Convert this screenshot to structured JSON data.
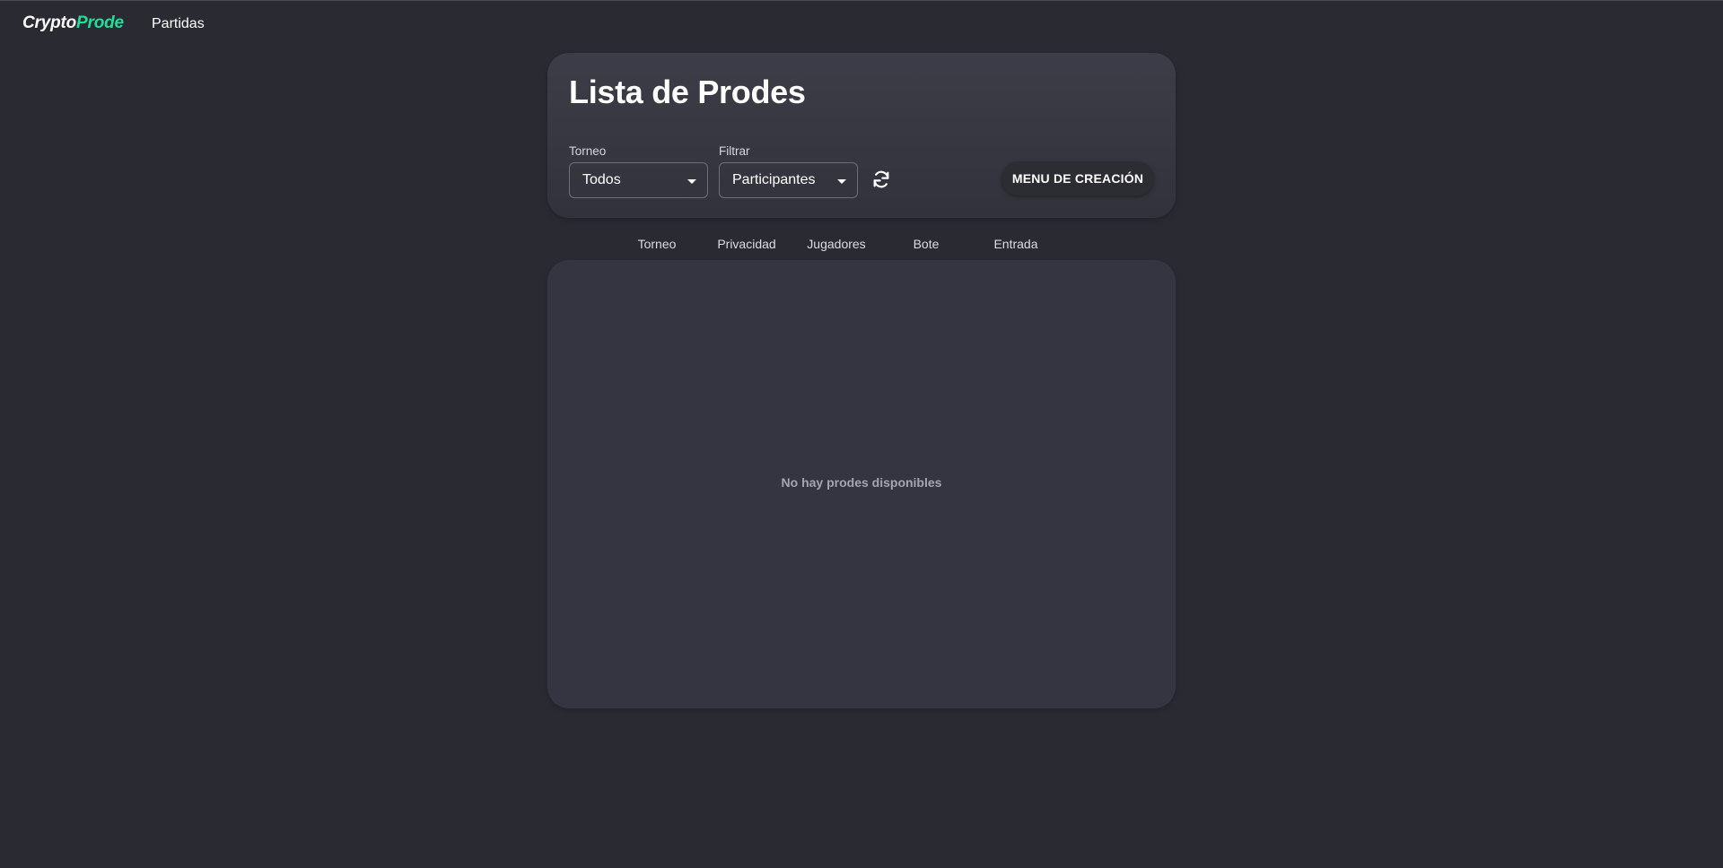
{
  "navbar": {
    "brand_part1": "Crypto",
    "brand_part2": "Prode",
    "brand_accent_color": "#22dd99",
    "links": [
      "Partidas"
    ]
  },
  "header": {
    "title": "Lista de Prodes",
    "filters": [
      {
        "label": "Torneo",
        "value": "Todos"
      },
      {
        "label": "Filtrar",
        "value": "Participantes"
      }
    ],
    "refresh_icon": "refresh-icon",
    "create_button_label": "MENU DE CREACIÓN"
  },
  "table": {
    "columns": [
      "Torneo",
      "Privacidad",
      "Jugadores",
      "Bote",
      "Entrada"
    ],
    "rows": [],
    "empty_message": "No hay prodes disponibles"
  }
}
